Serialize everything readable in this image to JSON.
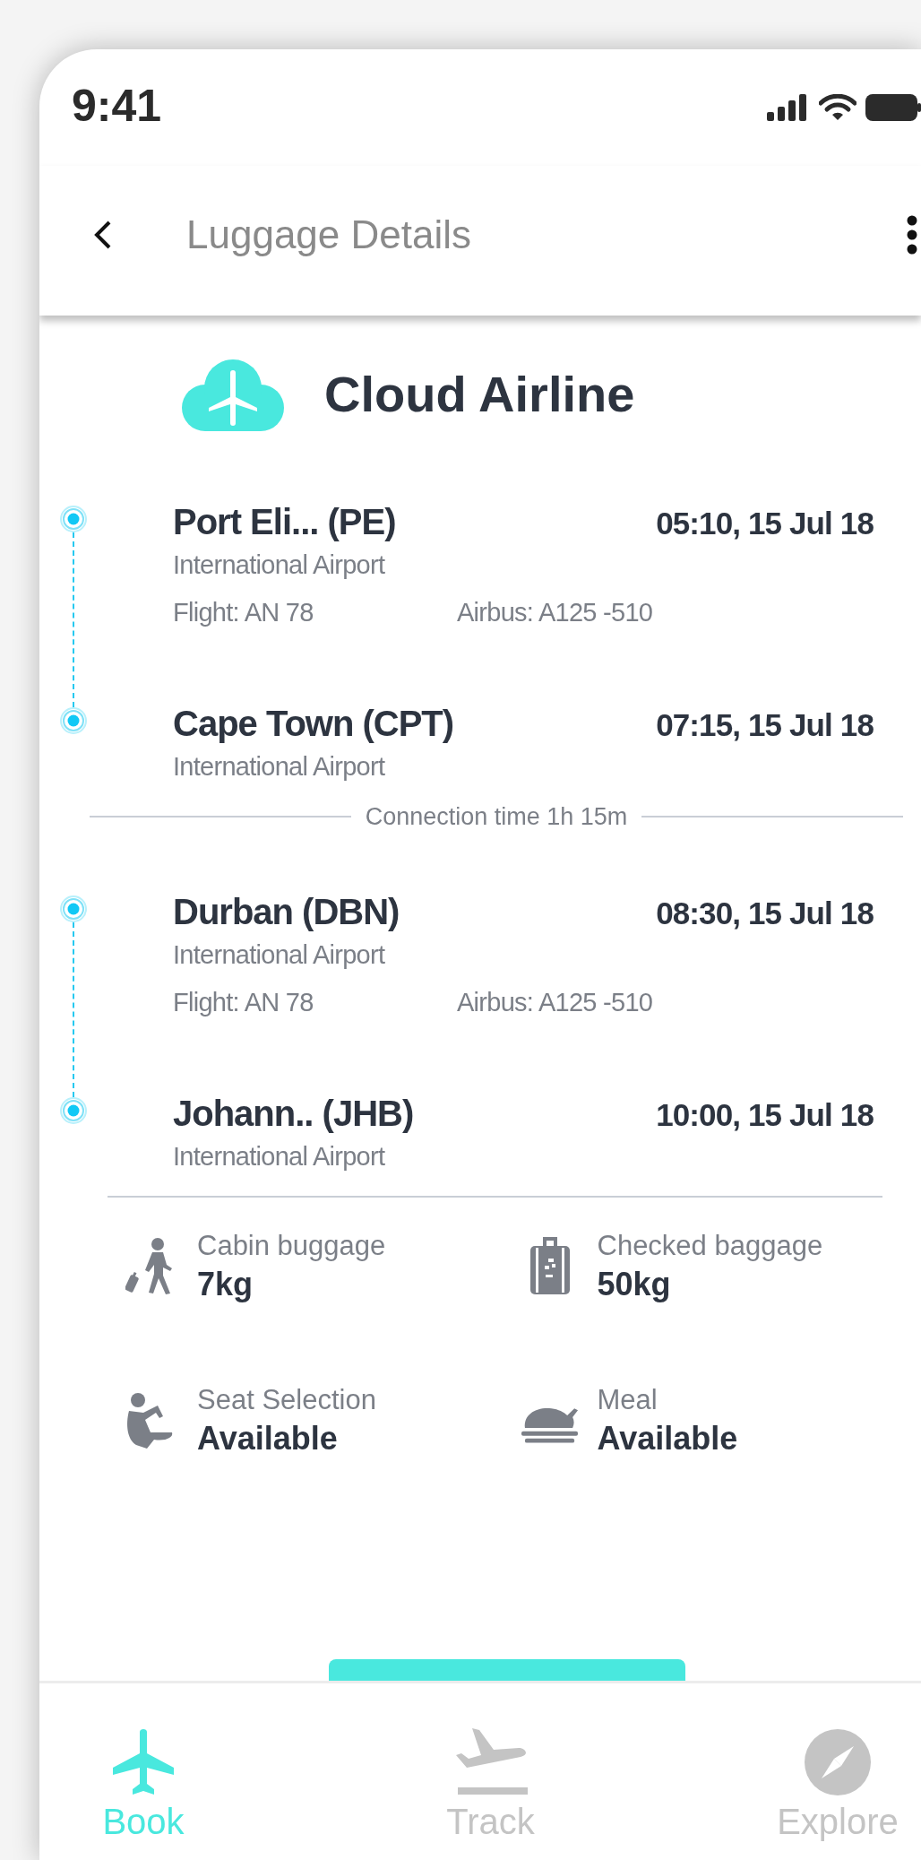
{
  "status_bar": {
    "time": "9:41"
  },
  "header": {
    "title": "Luggage Details"
  },
  "airline": {
    "name": "Cloud Airline"
  },
  "itinerary": [
    {
      "kind": "segment",
      "legs": [
        {
          "city": "Port Eli... (PE)",
          "airport": "International Airport",
          "time": "05:10, 15 Jul 18",
          "flight": "Flight: AN 78",
          "aircraft": "Airbus: A125 -510"
        },
        {
          "city": "Cape Town (CPT)",
          "airport": "International Airport",
          "time": "07:15, 15 Jul 18"
        }
      ]
    },
    {
      "kind": "connection",
      "text": "Connection time 1h 15m"
    },
    {
      "kind": "segment",
      "legs": [
        {
          "city": "Durban (DBN)",
          "airport": "International Airport",
          "time": "08:30, 15 Jul 18",
          "flight": "Flight: AN 78",
          "aircraft": "Airbus: A125 -510"
        },
        {
          "city": "Johann.. (JHB)",
          "airport": "International Airport",
          "time": "10:00, 15 Jul 18"
        }
      ]
    }
  ],
  "amenities": [
    {
      "kind": "cabin",
      "label": "Cabin buggage",
      "value": "7kg"
    },
    {
      "kind": "checked",
      "label": "Checked baggage",
      "value": "50kg"
    },
    {
      "kind": "seat",
      "label": "Seat Selection",
      "value": "Available"
    },
    {
      "kind": "meal",
      "label": "Meal",
      "value": "Available"
    }
  ],
  "nav": [
    {
      "kind": "book",
      "label": "Book",
      "selected": true
    },
    {
      "kind": "track",
      "label": "Track",
      "selected": false
    },
    {
      "kind": "explore",
      "label": "Explore",
      "selected": false
    }
  ]
}
